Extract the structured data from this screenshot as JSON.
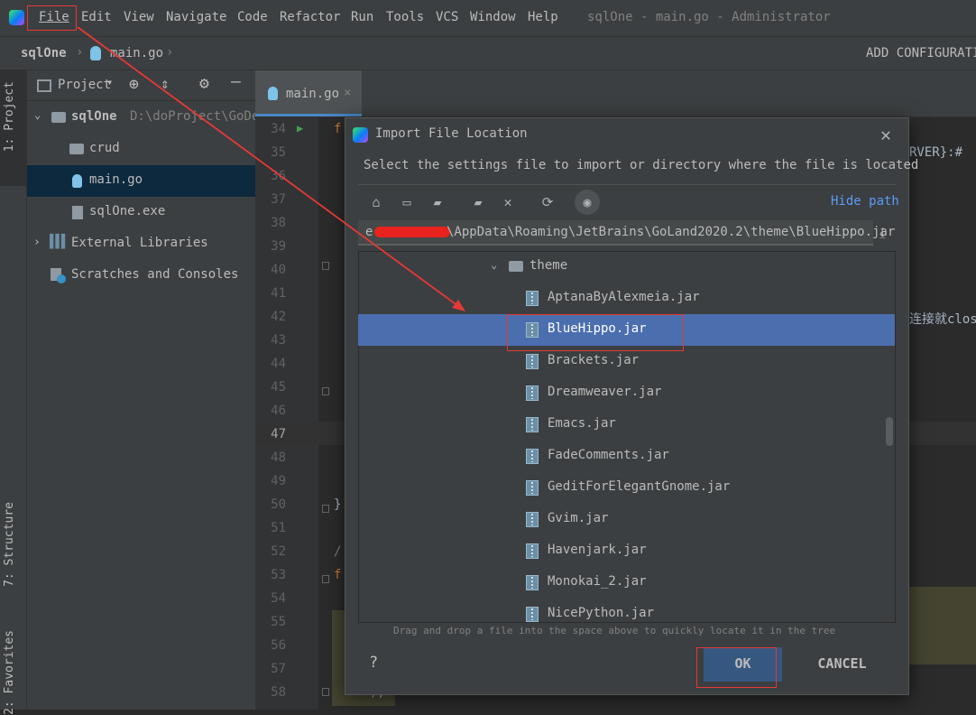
{
  "menubar": {
    "items": [
      "File",
      "Edit",
      "View",
      "Navigate",
      "Code",
      "Refactor",
      "Run",
      "Tools",
      "VCS",
      "Window",
      "Help"
    ],
    "window_title": "sqlOne - main.go - Administrator"
  },
  "navbar": {
    "breadcrumb_project": "sqlOne",
    "breadcrumb_file": "main.go",
    "add_config": "ADD CONFIGURATION"
  },
  "left_strip": {
    "project_tab": "1: Project",
    "structure_tab": "7: Structure",
    "favorites_tab": "2: Favorites"
  },
  "project_panel": {
    "view_selector": "Project",
    "tree": [
      {
        "label": "sqlOne",
        "path": "D:\\doProject\\GoDem"
      },
      {
        "label": "crud"
      },
      {
        "label": "main.go"
      },
      {
        "label": "sqlOne.exe"
      },
      {
        "label": "External Libraries"
      },
      {
        "label": "Scratches and Consoles"
      }
    ]
  },
  "editor": {
    "tab_label": "main.go",
    "line_numbers": [
      "34",
      "35",
      "36",
      "37",
      "38",
      "39",
      "40",
      "41",
      "42",
      "43",
      "44",
      "45",
      "46",
      "47",
      "48",
      "49",
      "50",
      "51",
      "52",
      "53",
      "54",
      "55",
      "56",
      "57",
      "58"
    ],
    "code_fragments": {
      "l34": "f",
      "l35_right": "RVER}:#",
      "l42_right": "连接就clos",
      "l50": "}",
      "l52": "/",
      "l53": "f",
      "l58": ");"
    }
  },
  "dialog": {
    "title": "Import File Location",
    "description": "Select the settings file to import or directory where the file is located",
    "hide_path": "Hide path",
    "path_prefix": "e",
    "path_value": "\\AppData\\Roaming\\JetBrains\\GoLand2020.2\\theme\\BlueHippo.jar",
    "folder": "theme",
    "files": [
      "AptanaByAlexmeia.jar",
      "BlueHippo.jar",
      "Brackets.jar",
      "Dreamweaver.jar",
      "Emacs.jar",
      "FadeComments.jar",
      "GeditForElegantGnome.jar",
      "Gvim.jar",
      "Havenjark.jar",
      "Monokai_2.jar",
      "NicePython.jar"
    ],
    "selected_file": "BlueHippo.jar",
    "drag_hint": "Drag and drop a file into the space above to quickly locate it in the tree",
    "help": "?",
    "ok": "OK",
    "cancel": "CANCEL"
  },
  "colors": {
    "accent": "#4b6eaf",
    "ok_button": "#365880",
    "annotation": "#e53935"
  }
}
